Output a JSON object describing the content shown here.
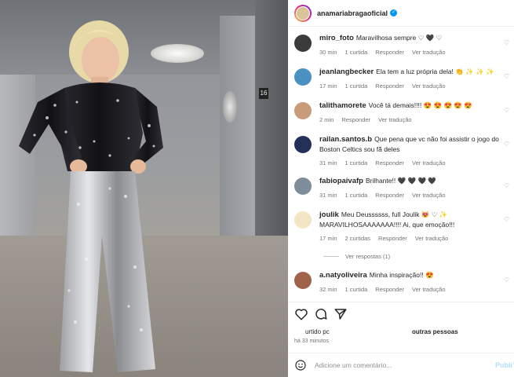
{
  "post": {
    "author": "anamariabragaoficial"
  },
  "comments": [
    {
      "user": "miro_foto",
      "text": "Maravilhosa sempre ♡ 🖤 ♡",
      "time": "30 min",
      "likes": "1 curtida",
      "reply": "Responder",
      "translate": "Ver tradução",
      "avatar_color": "#3b3b3b"
    },
    {
      "user": "jeanlangbecker",
      "text": "Ela tem a luz própria dela! 👏 ✨ ✨ ✨",
      "time": "17 min",
      "likes": "1 curtida",
      "reply": "Responder",
      "translate": "Ver tradução",
      "avatar_color": "#4a90c0"
    },
    {
      "user": "talithamorete",
      "text": "Você tá demais!!!! 😍 😍 😍 😍 😍",
      "time": "2 min",
      "likes": "",
      "reply": "Responder",
      "translate": "Ver tradução",
      "avatar_color": "#c89b7b"
    },
    {
      "user": "railan.santos.b",
      "text": "Que pena que vc não foi assistir o jogo do Boston Celtics sou fã deles",
      "time": "31 min",
      "likes": "1 curtida",
      "reply": "Responder",
      "translate": "Ver tradução",
      "avatar_color": "#22305a"
    },
    {
      "user": "fabiopaivafp",
      "text": "Brilhante!! 🖤 🖤 🖤 🖤",
      "time": "31 min",
      "likes": "1 curtida",
      "reply": "Responder",
      "translate": "Ver tradução",
      "avatar_color": "#7d8d9a"
    },
    {
      "user": "joulik",
      "text": "Meu Deussssss, full Joulik 😻 ♡ ✨ MARAVILHOSAAAAAAA!!!! Ai, que emoção!!!",
      "time": "17 min",
      "likes": "2 curtidas",
      "reply": "Responder",
      "translate": "Ver tradução",
      "avatar_color": "#f4e6c4"
    },
    {
      "user": "a.natyoliveira",
      "text": "Minha inspiração!! 😍",
      "time": "32 min",
      "likes": "1 curtida",
      "reply": "Responder",
      "translate": "Ver tradução",
      "avatar_color": "#a0624b"
    }
  ],
  "replies_label": "Ver respostas (1)",
  "likes_text": {
    "left": "urtido pc",
    "right": "outras pessoas"
  },
  "post_time": "há 33 minutos",
  "add_comment": {
    "placeholder": "Adicione um comentário...",
    "publish": "Publi"
  },
  "photo": {
    "floor_sign": "16"
  },
  "colors": {
    "verified": "#0095f6",
    "accent_link": "#0095f6",
    "muted": "#737373"
  },
  "icons": [
    "heart-icon",
    "comment-icon",
    "share-icon",
    "emoji-icon",
    "verified-badge-icon"
  ]
}
